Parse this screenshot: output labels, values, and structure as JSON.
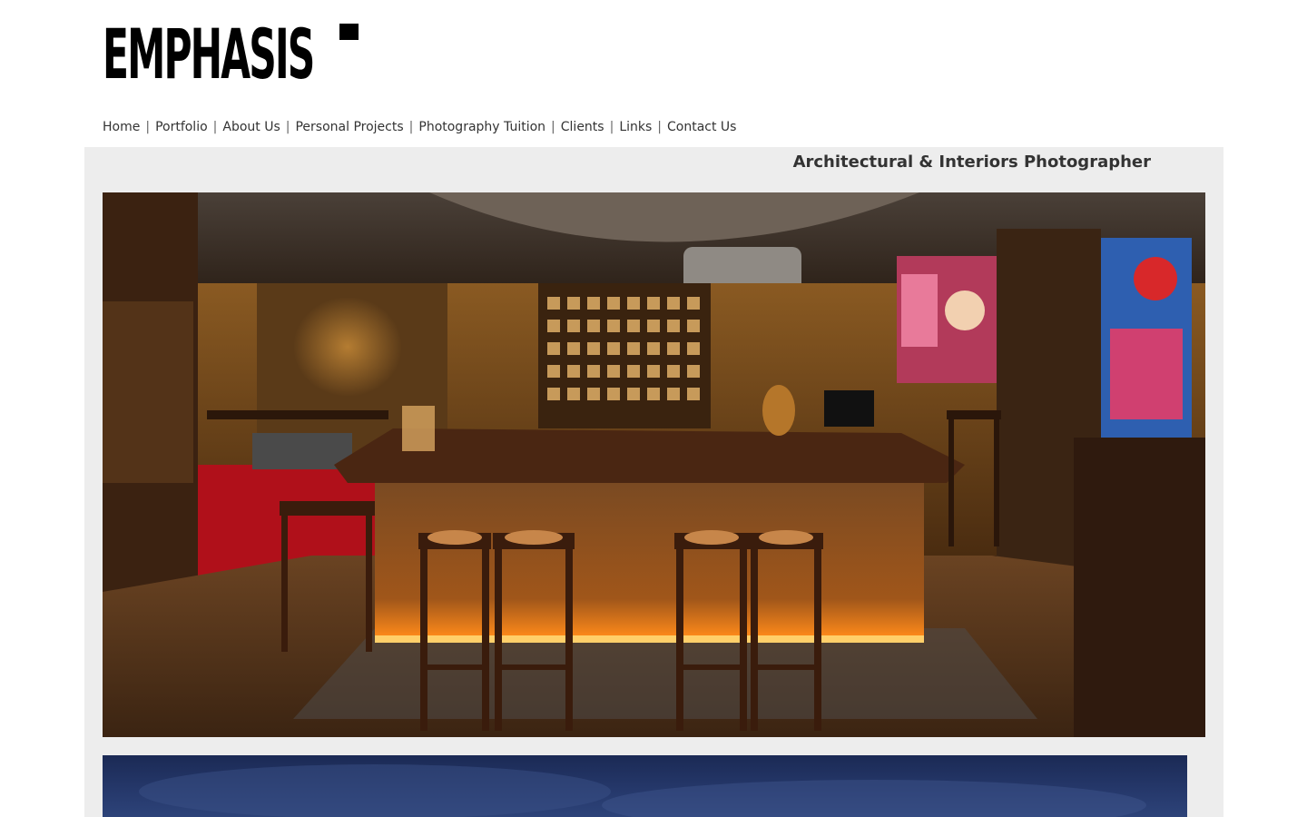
{
  "logo": {
    "text": "EMPHASIS"
  },
  "nav": {
    "items": [
      {
        "label": "Home"
      },
      {
        "label": "Portfolio"
      },
      {
        "label": "About Us"
      },
      {
        "label": "Personal Projects"
      },
      {
        "label": "Photography Tuition"
      },
      {
        "label": "Clients"
      },
      {
        "label": "Links"
      },
      {
        "label": "Contact Us"
      }
    ],
    "separator": "|"
  },
  "tagline": "Architectural & Interiors Photographer",
  "colors": {
    "panel": "#ededed",
    "text": "#333333"
  }
}
